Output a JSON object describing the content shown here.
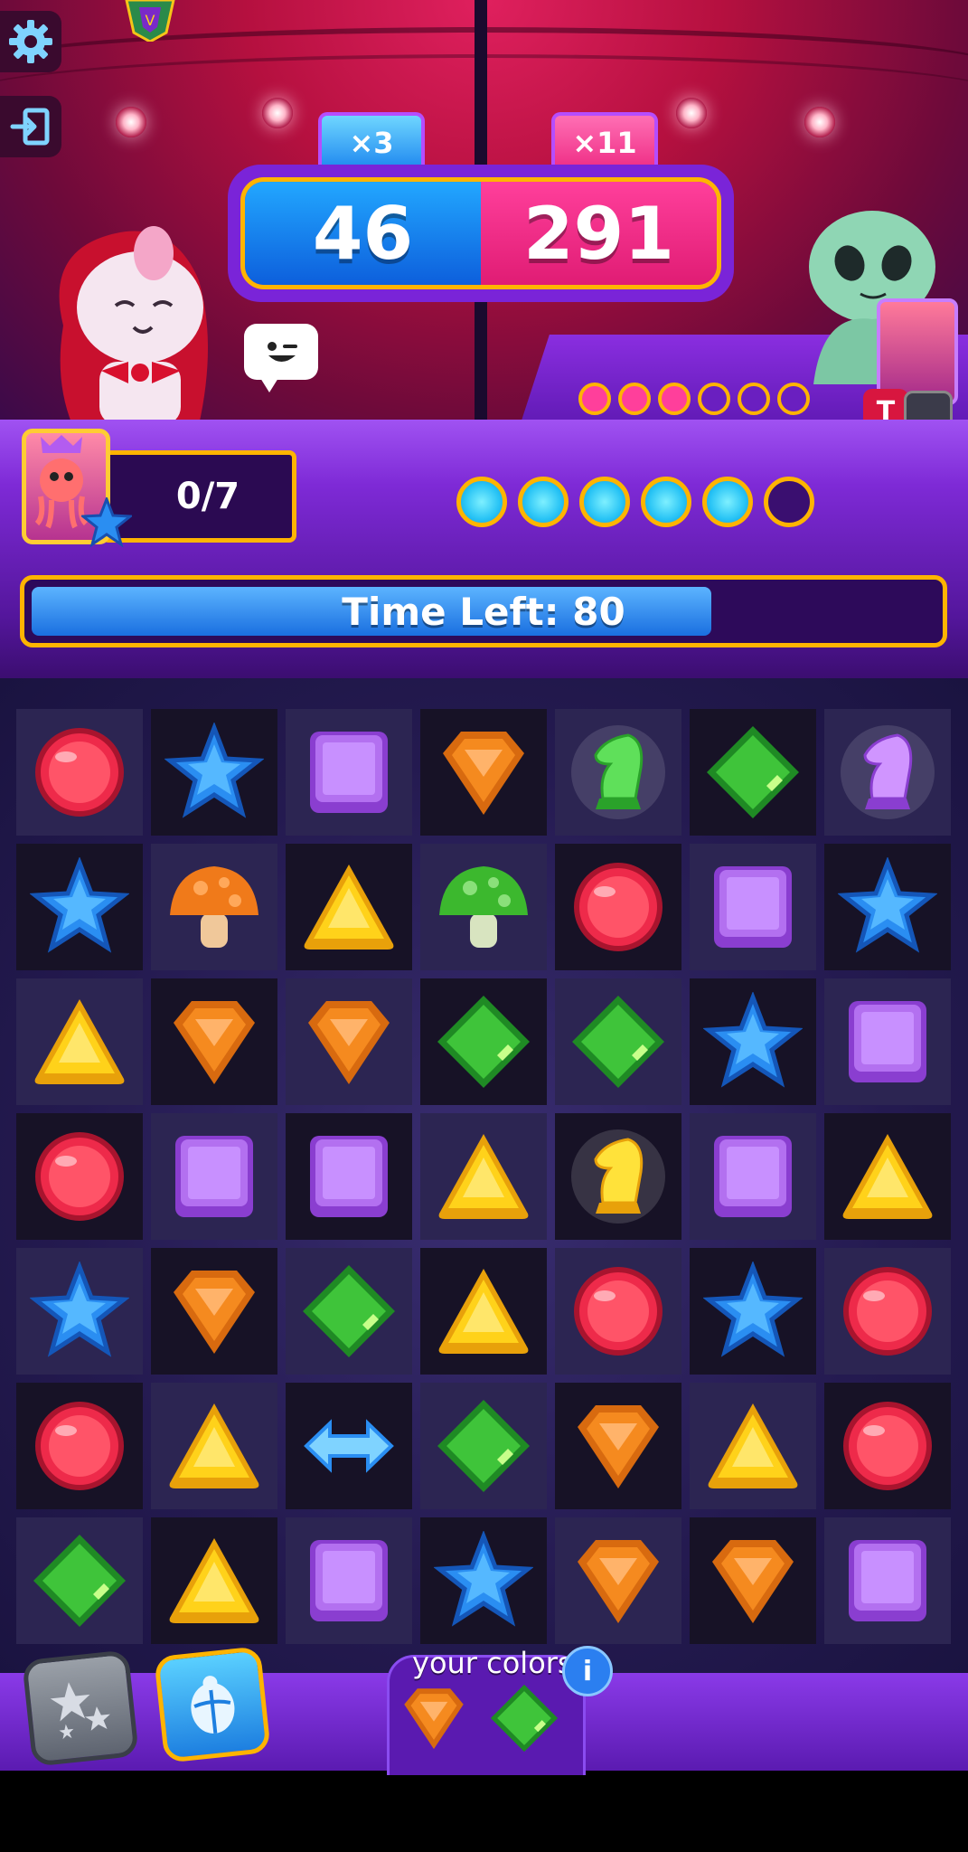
{
  "match": {
    "player_multiplier": "×3",
    "opponent_multiplier": "×11",
    "player_score": "46",
    "opponent_score": "291",
    "opponent_progress_dots_filled": 3,
    "opponent_progress_dots_total": 6
  },
  "player": {
    "progress_text": "0/7",
    "gem_dots_filled": 5,
    "gem_dots_total": 6
  },
  "timer": {
    "label": "Time Left: 80",
    "fill_fraction": 0.74
  },
  "board": {
    "rows": [
      [
        "red-circle",
        "blue-star",
        "purple-square",
        "orange-shield",
        "green-knight",
        "green-diamond",
        "purple-knight"
      ],
      [
        "blue-star",
        "orange-mushroom",
        "yellow-triangle",
        "green-mushroom",
        "red-circle",
        "purple-square",
        "blue-star"
      ],
      [
        "yellow-triangle",
        "orange-shield",
        "orange-shield",
        "green-diamond",
        "green-diamond",
        "blue-star",
        "purple-square"
      ],
      [
        "red-circle",
        "purple-square",
        "purple-square",
        "yellow-triangle",
        "yellow-knight",
        "purple-square",
        "yellow-triangle"
      ],
      [
        "blue-star",
        "orange-shield",
        "green-diamond",
        "yellow-triangle",
        "red-circle",
        "blue-star",
        "red-circle"
      ],
      [
        "red-circle",
        "yellow-triangle",
        "blue-arrow",
        "green-diamond",
        "orange-shield",
        "yellow-triangle",
        "red-circle"
      ],
      [
        "green-diamond",
        "yellow-triangle",
        "purple-square",
        "blue-star",
        "orange-shield",
        "orange-shield",
        "purple-square"
      ]
    ]
  },
  "bottom": {
    "colors_label": "your colors",
    "info_icon": "i",
    "your_colors": [
      "orange-shield",
      "green-diamond"
    ],
    "powerups": [
      "stars-powerup-icon",
      "scarab-powerup-icon"
    ]
  },
  "icons": {
    "settings": "gear-icon",
    "exit": "exit-icon",
    "emote": "wink-emote-icon",
    "hammer": "T"
  },
  "colors": {
    "red": "#ee2a4a",
    "blue": "#2a8ef2",
    "purple": "#b370f0",
    "orange": "#f58a1f",
    "yellow": "#ffd21a",
    "green": "#3fc43a",
    "accent_gold": "#ffb400"
  }
}
